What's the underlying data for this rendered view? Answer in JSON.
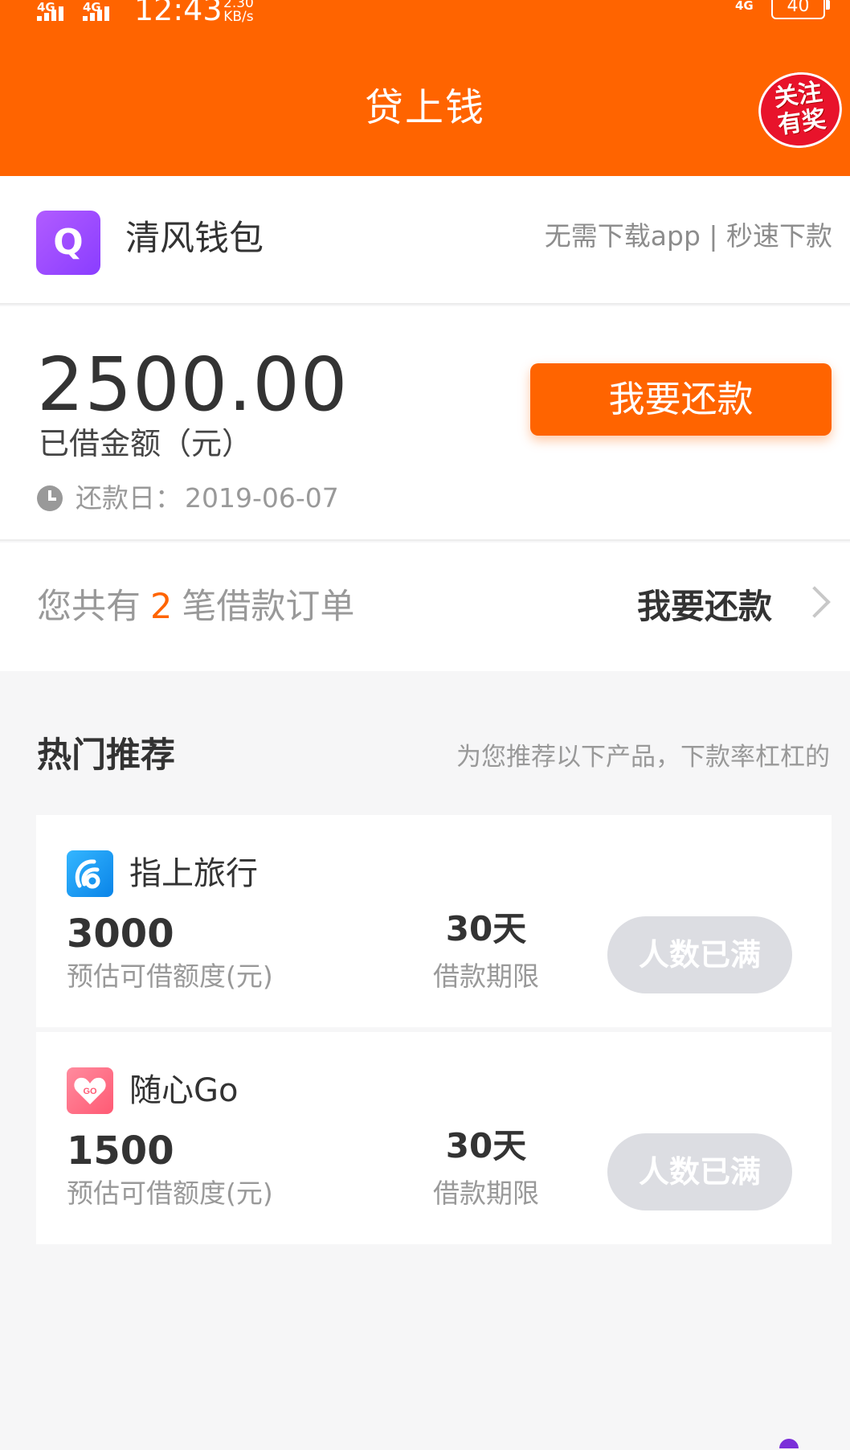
{
  "status_bar": {
    "signal_1": "4G",
    "signal_2": "4G",
    "time": "12:43",
    "net_speed_value": "2.30",
    "net_speed_unit": "KB/s",
    "network": "4G",
    "battery": "40"
  },
  "header": {
    "title": "贷上钱",
    "promo_badge_line1": "关注",
    "promo_badge_line2": "有奖"
  },
  "product": {
    "logo_letter": "Q",
    "name": "清风钱包",
    "tagline": "无需下载app | 秒速下款"
  },
  "loan": {
    "amount": "2500.00",
    "amount_label": "已借金额（元）",
    "due_label": "还款日：",
    "due_date": "2019-06-07",
    "repay_button": "我要还款"
  },
  "orders": {
    "prefix": "您共有",
    "count": "2",
    "suffix": "笔借款订单",
    "action": "我要还款"
  },
  "recommend": {
    "title": "热门推荐",
    "subtitle": "为您推荐以下产品，下款率杠杠的",
    "items": [
      {
        "name": "指上旅行",
        "icon_name": "zhishang-travel-logo-icon",
        "amount": "3000",
        "amount_label": "预估可借额度(元)",
        "term": "30天",
        "term_label": "借款期限",
        "button": "人数已满"
      },
      {
        "name": "随心Go",
        "icon_name": "suixin-go-logo-icon",
        "icon_text": "GO",
        "amount": "1500",
        "amount_label": "预估可借额度(元)",
        "term": "30天",
        "term_label": "借款期限",
        "button": "人数已满"
      }
    ]
  },
  "colors": {
    "brand": "#ff6400",
    "disabled_button": "#dcdde2",
    "muted_text": "#999999"
  }
}
